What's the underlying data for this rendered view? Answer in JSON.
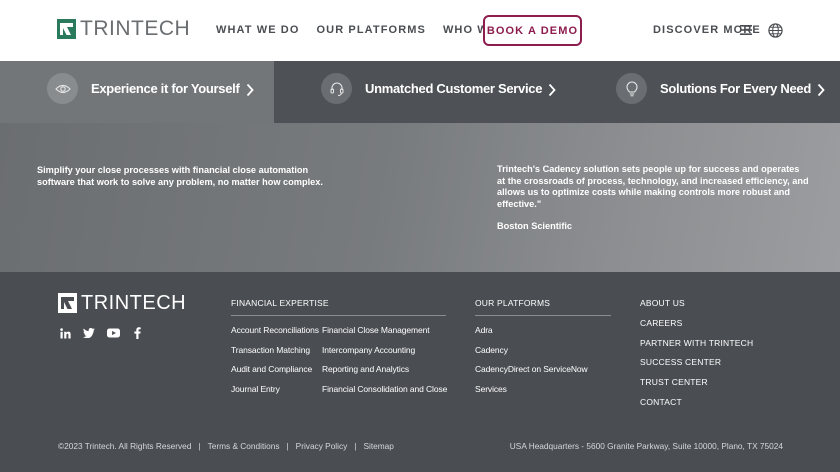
{
  "header": {
    "logo_text": "TRINTECH",
    "nav": [
      "WHAT WE DO",
      "OUR PLATFORMS",
      "WHO WE SERVE"
    ],
    "demo_button": "BOOK A DEMO",
    "discover": "DISCOVER MORE"
  },
  "tabs": [
    {
      "label": "Experience it for Yourself",
      "icon": "eye-icon"
    },
    {
      "label": "Unmatched Customer Service",
      "icon": "headset-icon"
    },
    {
      "label": "Solutions For Every Need",
      "icon": "lightbulb-icon"
    }
  ],
  "banner": {
    "left_text": "Simplify your close processes with financial close automation software that work to solve any problem, no matter how complex.",
    "quote": "Trintech's Cadency solution sets people up for success and operates at the crossroads of process, technology, and increased efficiency, and allows us to optimize costs while making controls more robust and effective.\"",
    "source": "Boston Scientific"
  },
  "footer": {
    "logo_text": "TRINTECH",
    "social": [
      "linkedin-icon",
      "twitter-icon",
      "youtube-icon",
      "facebook-icon"
    ],
    "financial_expertise": {
      "title": "FINANCIAL EXPERTISE",
      "col1": [
        "Account Reconciliations",
        "Transaction Matching",
        "Audit and Compliance",
        "Journal Entry"
      ],
      "col2": [
        "Financial Close Management",
        "Intercompany Accounting",
        "Reporting and Analytics",
        "Financial Consolidation and Close"
      ]
    },
    "platforms": {
      "title": "OUR PLATFORMS",
      "items": [
        "Adra",
        "Cadency",
        "CadencyDirect on ServiceNow",
        "Services"
      ]
    },
    "right_links": [
      "ABOUT US",
      "CAREERS",
      "PARTNER WITH TRINTECH",
      "SUCCESS CENTER",
      "TRUST CENTER",
      "CONTACT"
    ],
    "copyright": "©2023 Trintech. All Rights Reserved",
    "legal": [
      "Terms & Conditions",
      "Privacy Policy",
      "Sitemap"
    ],
    "separator": "|",
    "address": "USA Headquarters - 5600 Granite Parkway, Suite 10000, Plano, TX 75024"
  },
  "colors": {
    "brand_green": "#2a7a5e",
    "accent_burgundy": "#8c1d4e",
    "footer_bg": "#4a4d52"
  }
}
